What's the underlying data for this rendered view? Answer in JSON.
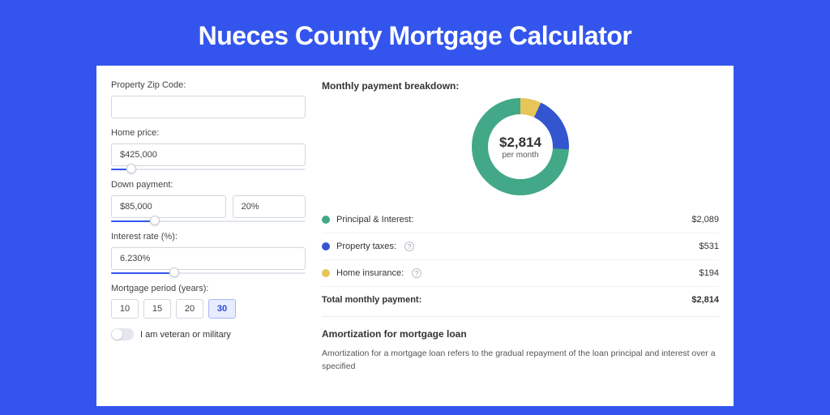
{
  "title": "Nueces County Mortgage Calculator",
  "form": {
    "zip": {
      "label": "Property Zip Code:",
      "value": ""
    },
    "homePrice": {
      "label": "Home price:",
      "value": "$425,000",
      "sliderPct": 8
    },
    "downPayment": {
      "label": "Down payment:",
      "amount": "$85,000",
      "percent": "20%",
      "sliderPct": 20
    },
    "interestRate": {
      "label": "Interest rate (%):",
      "value": "6.230%",
      "sliderPct": 30
    },
    "period": {
      "label": "Mortgage period (years):",
      "options": [
        "10",
        "15",
        "20",
        "30"
      ],
      "selected": "30"
    },
    "veteran": {
      "label": "I am veteran or military",
      "checked": false
    }
  },
  "breakdown": {
    "heading": "Monthly payment breakdown:",
    "centerValue": "$2,814",
    "centerSub": "per month",
    "rows": [
      {
        "color": "green",
        "label": "Principal & Interest:",
        "info": false,
        "value": "$2,089"
      },
      {
        "color": "blue",
        "label": "Property taxes:",
        "info": true,
        "value": "$531"
      },
      {
        "color": "yellow",
        "label": "Home insurance:",
        "info": true,
        "value": "$194"
      }
    ],
    "totalLabel": "Total monthly payment:",
    "totalValue": "$2,814"
  },
  "amortization": {
    "title": "Amortization for mortgage loan",
    "text": "Amortization for a mortgage loan refers to the gradual repayment of the loan principal and interest over a specified"
  },
  "chart_data": {
    "type": "pie",
    "title": "Monthly payment breakdown",
    "series": [
      {
        "name": "Principal & Interest",
        "value": 2089,
        "color": "#42a887"
      },
      {
        "name": "Property taxes",
        "value": 531,
        "color": "#3355cf"
      },
      {
        "name": "Home insurance",
        "value": 194,
        "color": "#e8c55a"
      }
    ],
    "total": 2814
  }
}
